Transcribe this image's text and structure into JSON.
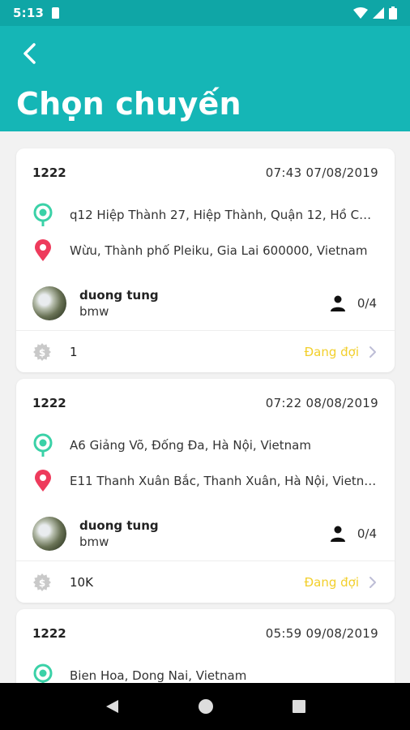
{
  "status_bar": {
    "time": "5:13"
  },
  "header": {
    "title": "Chọn chuyến"
  },
  "trips": [
    {
      "code": "1222",
      "datetime": "07:43 07/08/2019",
      "pickup": "q12 Hiệp Thành 27, Hiệp Thành, Quận 12, Hồ Chí...",
      "dropoff": "Wừu, Thành phố Pleiku, Gia Lai 600000, Vietnam",
      "driver": {
        "name": "duong tung",
        "car": "bmw"
      },
      "seats": "0/4",
      "price": "1",
      "status": "Đang đợi"
    },
    {
      "code": "1222",
      "datetime": "07:22 08/08/2019",
      "pickup": "A6 Giảng Võ, Đống Đa, Hà Nội, Vietnam",
      "dropoff": "E11 Thanh Xuân Bắc, Thanh Xuân, Hà Nội, Vietnam",
      "driver": {
        "name": "duong tung",
        "car": "bmw"
      },
      "seats": "0/4",
      "price": "10K",
      "status": "Đang đợi"
    },
    {
      "code": "1222",
      "datetime": "05:59 09/08/2019",
      "pickup": "Bien Hoa, Dong Nai, Vietnam"
    }
  ],
  "colors": {
    "header": "#15b6b6",
    "status_bar": "#0fa6a6",
    "pickup_pin": "#3ad1a7",
    "dropoff_pin": "#ee3b5c",
    "status_waiting": "#f2cf2b"
  },
  "icons": {
    "back": "arrow-left-icon",
    "pickup": "pickup-pin-icon",
    "dropoff": "dropoff-pin-icon",
    "seats": "person-icon",
    "price": "dollar-coin-icon",
    "detail": "chevron-right-icon"
  }
}
